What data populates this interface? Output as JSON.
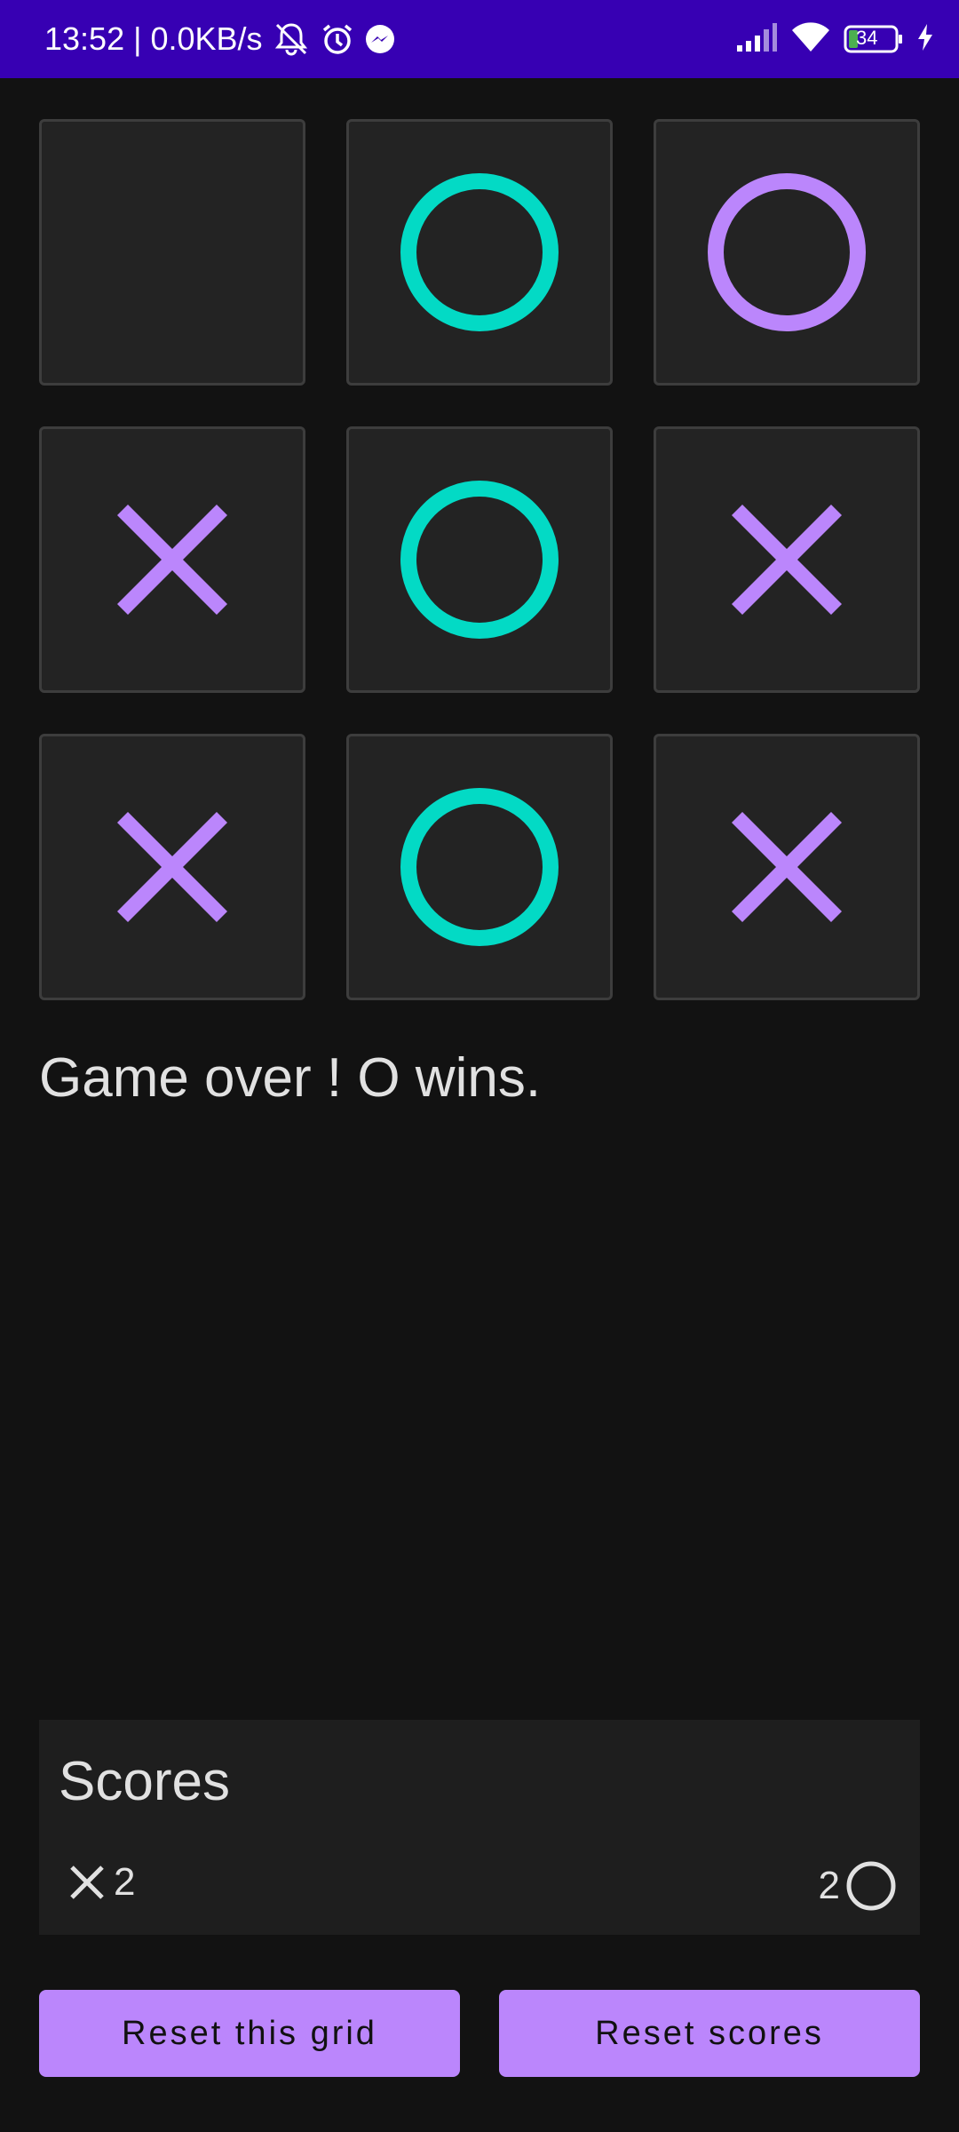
{
  "status_bar": {
    "time": "13:52",
    "separator": "|",
    "data_rate": "0.0KB/s",
    "battery": "34",
    "icons": [
      "mute-notification-icon",
      "alarm-icon",
      "messenger-icon",
      "signal-icon",
      "wifi-icon",
      "battery-icon",
      "charging-icon"
    ],
    "background": "#3700b3"
  },
  "board": {
    "cells": [
      "",
      "O",
      "O",
      "X",
      "O",
      "X",
      "X",
      "O",
      "X"
    ],
    "cell_marks_color": [
      "",
      "#03dac5",
      "#bb86fc",
      "#bb86fc",
      "#03dac5",
      "#bb86fc",
      "#bb86fc",
      "#03dac5",
      "#bb86fc"
    ]
  },
  "message": "Game over ! O wins.",
  "scores": {
    "title": "Scores",
    "x_score": "2",
    "o_score": "2"
  },
  "buttons": {
    "reset_grid": "Reset this grid",
    "reset_scores": "Reset scores"
  },
  "colors": {
    "background": "#121212",
    "cell": "#232323",
    "accent_purple": "#bb86fc",
    "accent_teal": "#03dac5"
  }
}
